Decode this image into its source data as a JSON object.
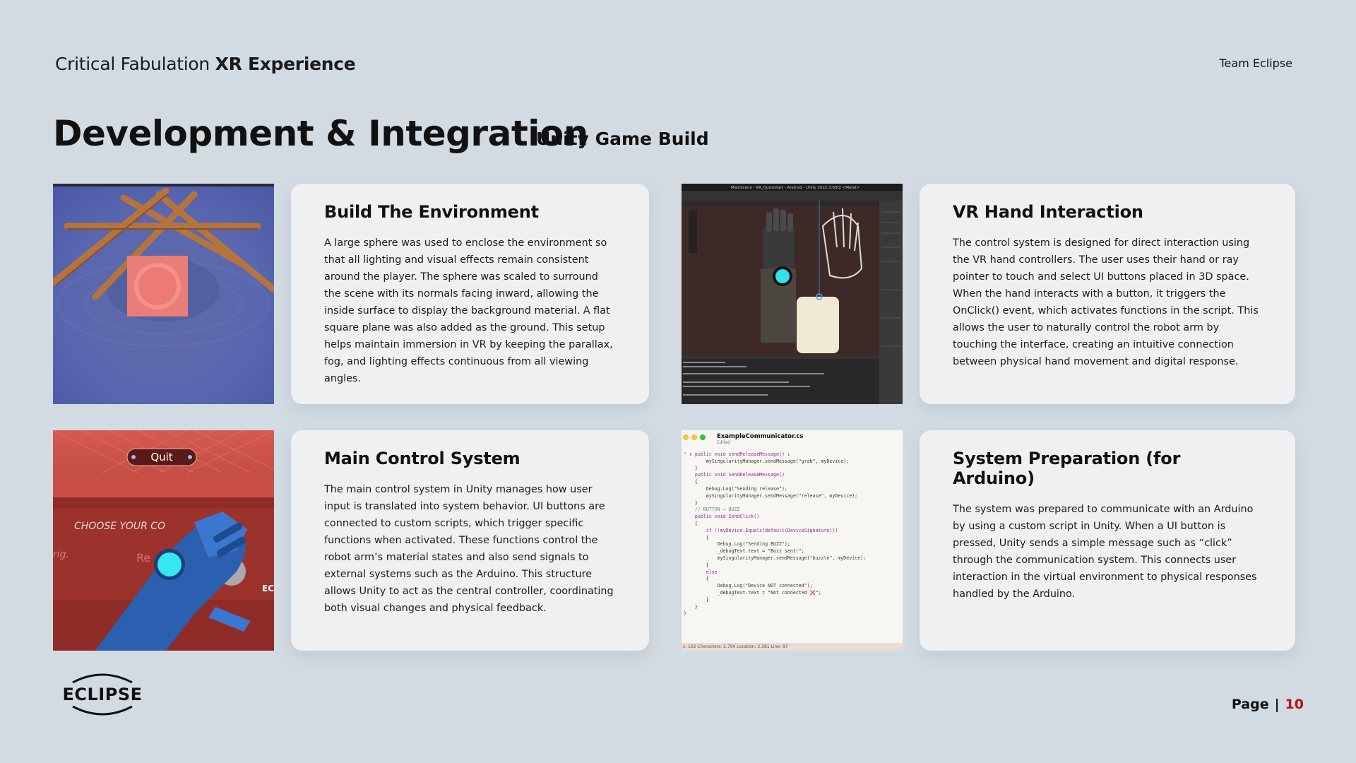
{
  "header": {
    "title_light": "Critical Fabulation",
    "title_bold": "XR Experience",
    "team": "Team Eclipse"
  },
  "page": {
    "title": "Development & Integration",
    "subtitle": "Unity Game Build",
    "page_label": "Page",
    "page_separator": "|",
    "page_number": "10"
  },
  "cards": [
    {
      "title": "Build The Environment",
      "body": "A large sphere was used to enclose the environment so that all lighting and visual effects remain consistent around the player. The sphere was scaled to surround the scene with its normals facing inward, allowing the inside surface to display the background material. A flat square plane was also added as the ground. This setup helps maintain immersion in VR by keeping the parallax, fog, and lighting effects continuous from all viewing angles."
    },
    {
      "title": "VR Hand Interaction",
      "body": "The control system is designed for direct interaction using the VR hand controllers. The user uses their hand or ray pointer to touch and select UI buttons placed in 3D space. When the hand interacts with a button, it triggers the OnClick() event, which activates functions in the script. This allows the user to naturally control the robot arm by touching the interface, creating an intuitive connection between physical hand movement and digital response."
    },
    {
      "title": "Main Control System",
      "body": "The main control system in Unity manages how user input is translated into system behavior. UI buttons are connected to custom scripts, which trigger specific functions when activated. These functions control the robot arm’s material states and also send signals to external systems such as the Arduino. This structure allows Unity to act as the central controller, coordinating both visual changes and physical feedback."
    },
    {
      "title": "System Preparation (for Arduino)",
      "body": "The system was prepared to communicate with an Arduino by using a custom script in Unity. When a UI button is pressed, Unity sends a simple message such as “click” through the communication system. This connects user interaction in the virtual environment to physical responses handled by the Arduino."
    }
  ],
  "images": {
    "vr_menu": {
      "quit_label": "Quit",
      "choose_label": "CHOOSE YOUR CO",
      "left_label": "rig.",
      "button_label": "Re",
      "right_label": "EC"
    },
    "unity_editor": {
      "window_title": "MainScene - XR_Quickstart - Android - Unity 2022.3.63f2 <Metal>"
    },
    "code_editor": {
      "file_name": "ExampleCommunicator.cs",
      "status": "Edited",
      "lines": [
        "⌃ ∨ public void sendReleaseMessage() ↕",
        "        mySingularityManager.sendMessage(\"grab\", myDevice);",
        "    }",
        "",
        "    public void SendReleaseMessage()",
        "    {",
        "        Debug.Log(\"Sending release\");",
        "        mySingularityManager.sendMessage(\"release\", myDevice);",
        "    }",
        "",
        "    // BUTTON → BUZZ",
        "    public void SendClick()",
        "    {",
        "        if (!myDevice.Equals(default(DeviceSignature)))",
        "        {",
        "            Debug.Log(\"Sending BUZZ\");",
        "            _debugText.text = \"Buzz sent!\";",
        "            mySingularityManager.sendMessage(\"buzz\\n\", myDevice);",
        "        }",
        "        else",
        "        {",
        "            Debug.Log(\"Device NOT connected\");",
        "            _debugText.text = \"Not connected ❌\";",
        "        }",
        "    }",
        "}"
      ],
      "footer": "s: 102  Characters: 2,790  Location: 2,381  Line: 87"
    }
  },
  "logo": {
    "text": "ECLIPSE"
  }
}
